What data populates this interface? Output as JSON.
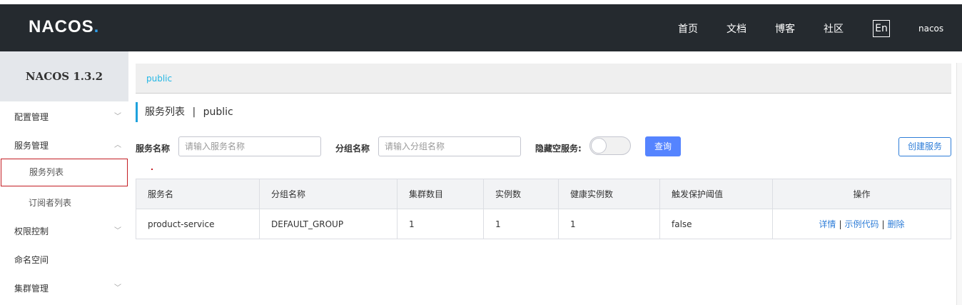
{
  "header": {
    "logo_main": "NACOS",
    "logo_dot": ".",
    "nav": [
      "首页",
      "文档",
      "博客",
      "社区"
    ],
    "lang": "En",
    "user": "nacos"
  },
  "sidebar": {
    "title": "NACOS 1.3.2",
    "items": [
      {
        "label": "配置管理",
        "chevron": "﹀"
      },
      {
        "label": "服务管理",
        "chevron": "︿"
      },
      {
        "label": "服务列表"
      },
      {
        "label": "订阅者列表"
      },
      {
        "label": "权限控制",
        "chevron": "﹀"
      },
      {
        "label": "命名空间"
      },
      {
        "label": "集群管理",
        "chevron": "﹀"
      }
    ]
  },
  "main": {
    "breadcrumb": "public",
    "title_main": "服务列表",
    "title_sep": "|",
    "title_ns": "public",
    "filters": {
      "service_name_label": "服务名称",
      "service_name_placeholder": "请输入服务名称",
      "group_name_label": "分组名称",
      "group_name_placeholder": "请输入分组名称",
      "hide_empty_label": "隐藏空服务:",
      "hide_empty_value": false
    },
    "query_button": "查询",
    "create_button": "创建服务",
    "table": {
      "columns": [
        "服务名",
        "分组名称",
        "集群数目",
        "实例数",
        "健康实例数",
        "触发保护阈值",
        "操作"
      ],
      "rows": [
        {
          "service": "product-service",
          "group": "DEFAULT_GROUP",
          "clusters": "1",
          "instances": "1",
          "healthy": "1",
          "threshold": "false",
          "ops": [
            "详情",
            "示例代码",
            "删除"
          ]
        }
      ],
      "op_sep": "|"
    }
  },
  "colors": {
    "header_bg": "#252a2f",
    "accent": "#5584ff",
    "link": "#2f7ed8",
    "active_border": "#c41d24"
  }
}
